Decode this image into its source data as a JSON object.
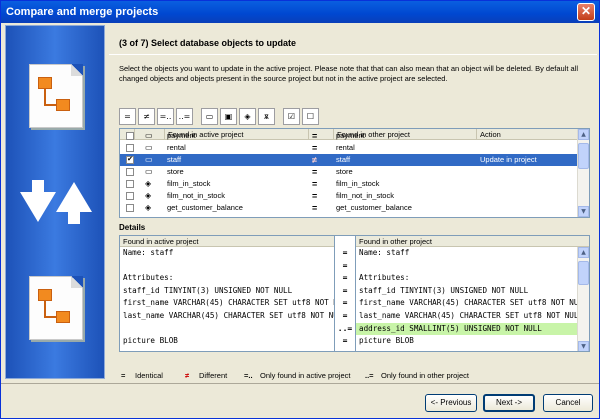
{
  "window": {
    "title": "Compare and merge projects",
    "close_glyph": "✕"
  },
  "step": {
    "heading": "(3 of 7) Select database objects to update",
    "description": "Select the objects you want to update in the active project. Please note that that can also mean that an object will be deleted. By default all changed objects and objects present in the source project but not in the active project are selected."
  },
  "toolbar": {
    "buttons": [
      {
        "icon": "identical-icon",
        "glyph": "="
      },
      {
        "icon": "different-icon",
        "glyph": "≠"
      },
      {
        "icon": "only-active-icon",
        "glyph": "=.."
      },
      {
        "icon": "only-other-icon",
        "glyph": "..="
      },
      {
        "icon": "table-icon",
        "glyph": "▭"
      },
      {
        "icon": "view-icon",
        "glyph": "▣"
      },
      {
        "icon": "procedure-icon",
        "glyph": "◈"
      },
      {
        "icon": "trigger-icon",
        "glyph": "ѫ"
      },
      {
        "icon": "check-all-icon",
        "glyph": "☑"
      },
      {
        "icon": "uncheck-all-icon",
        "glyph": "☐"
      }
    ]
  },
  "objects": {
    "headers": {
      "active": "Found in active project",
      "other": "Found in other project",
      "action": "Action"
    },
    "rows": [
      {
        "checked": false,
        "icon": "▭",
        "active": "payment",
        "status": "=",
        "other": "payment",
        "action": "",
        "selected": false
      },
      {
        "checked": false,
        "icon": "▭",
        "active": "rental",
        "status": "=",
        "other": "rental",
        "action": "",
        "selected": false
      },
      {
        "checked": true,
        "icon": "▭",
        "active": "staff",
        "status": "≠",
        "other": "staff",
        "action": "Update in project",
        "selected": true
      },
      {
        "checked": false,
        "icon": "▭",
        "active": "store",
        "status": "=",
        "other": "store",
        "action": "",
        "selected": false
      },
      {
        "checked": false,
        "icon": "◈",
        "active": "film_in_stock",
        "status": "=",
        "other": "film_in_stock",
        "action": "",
        "selected": false
      },
      {
        "checked": false,
        "icon": "◈",
        "active": "film_not_in_stock",
        "status": "=",
        "other": "film_not_in_stock",
        "action": "",
        "selected": false
      },
      {
        "checked": false,
        "icon": "◈",
        "active": "get_customer_balance",
        "status": "=",
        "other": "get_customer_balance",
        "action": "",
        "selected": false
      }
    ]
  },
  "details": {
    "label": "Details",
    "active_header": "Found in active project",
    "other_header": "Found in other project",
    "active_lines": [
      "Name: staff",
      "",
      "Attributes:",
      "staff_id TINYINT(3) UNSIGNED NOT NULL",
      "first_name VARCHAR(45) CHARACTER SET utf8 NOT NULL",
      "last_name VARCHAR(45) CHARACTER SET utf8 NOT NULL",
      "",
      "picture BLOB"
    ],
    "gutter": [
      "=",
      "=",
      "=",
      "=",
      "=",
      "=",
      "..=",
      "="
    ],
    "other_lines": [
      "Name: staff",
      "",
      "Attributes:",
      "staff_id TINYINT(3) UNSIGNED NOT NULL",
      "first_name VARCHAR(45) CHARACTER SET utf8 NOT NULL",
      "last_name VARCHAR(45) CHARACTER SET utf8 NOT NULL",
      "address_id SMALLINT(5) UNSIGNED NOT NULL",
      "picture BLOB"
    ],
    "highlight_color": "#c8f4a8"
  },
  "legend": {
    "identical": "Identical",
    "different": "Different",
    "only_active": "Only found in active project",
    "only_other": "Only found in other project"
  },
  "buttons": {
    "previous": "<- Previous",
    "next": "Next ->",
    "cancel": "Cancel"
  },
  "colors": {
    "title_bar": "#0047d0",
    "selection": "#316ac5",
    "orange": "#f28a1f"
  }
}
